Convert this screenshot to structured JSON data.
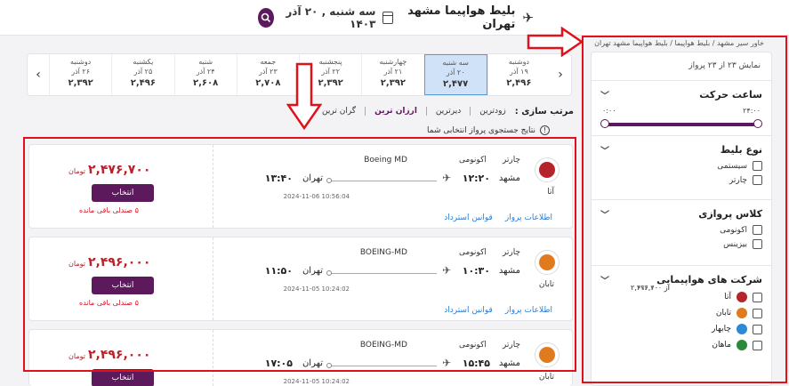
{
  "header": {
    "title": "بلیط هواپیما مشهد تهران",
    "date": "سه شنبه , ۲۰ آذر ۱۴۰۳",
    "search_icon": "search-icon",
    "plane_icon": "airplane-icon",
    "calendar_icon": "calendar-icon"
  },
  "breadcrumb": "خاور سیر مشهد / بلیط هواپیما / بلیط هواپیما مشهد تهران",
  "sidebar": {
    "count_text": "نمایش ۲۳ از ۲۳ پرواز",
    "time_section": {
      "title": "ساعت حرکت",
      "from": "۰:۰۰",
      "to": "۲۴:۰۰"
    },
    "ticket_type": {
      "title": "نوع بلیط",
      "options": [
        "سیستمی",
        "چارتر"
      ]
    },
    "flight_class": {
      "title": "کلاس پروازی",
      "options": [
        "اکونومی",
        "بیزینس"
      ]
    },
    "airlines": {
      "title": "شرکت های هواپیمایی",
      "items": [
        {
          "name": "آتا",
          "price": "از ۲,۴۷۶,۷۰۰",
          "color": "#b5242a"
        },
        {
          "name": "تابان",
          "price": "از ۲,۴۹۶,۰۰۰",
          "color": "#e07a1f"
        },
        {
          "name": "چابهار",
          "price": "از ۲,۶۰۰,۰۰۰",
          "color": "#2b8ad3"
        },
        {
          "name": "ماهان",
          "price": "از ۲,۶۰۷,۴۰۰",
          "color": "#2a8a3a"
        }
      ]
    }
  },
  "datestrip": {
    "days": [
      {
        "name": "دوشنبه",
        "date": "۱۹ آذر",
        "price": "۲,۴۹۶",
        "selected": false
      },
      {
        "name": "سه شنبه",
        "date": "۲۰ آذر",
        "price": "۲,۴۷۷",
        "selected": true
      },
      {
        "name": "چهارشنبه",
        "date": "۲۱ آذر",
        "price": "۲,۳۹۲",
        "selected": false
      },
      {
        "name": "پنجشنبه",
        "date": "۲۲ آذر",
        "price": "۲,۳۹۲",
        "selected": false
      },
      {
        "name": "جمعه",
        "date": "۲۳ آذر",
        "price": "۲,۷۰۸",
        "selected": false
      },
      {
        "name": "شنبه",
        "date": "۲۴ آذر",
        "price": "۲,۶۰۸",
        "selected": false
      },
      {
        "name": "یکشنبه",
        "date": "۲۵ آذر",
        "price": "۲,۴۹۶",
        "selected": false
      },
      {
        "name": "دوشنبه",
        "date": "۲۶ آذر",
        "price": "۲,۳۹۲",
        "selected": false
      }
    ]
  },
  "sort": {
    "label": "مرتب سازی :",
    "options": [
      "زودترین",
      "دیرترین",
      "ارزان ترین",
      "گران ترین"
    ],
    "active": 2
  },
  "notice": "نتایج جستجوی پرواز انتخابی شما",
  "flights": [
    {
      "airline": "آتا",
      "logo_color": "#b5242a",
      "type": "چارتر",
      "class": "اکونومی",
      "aircraft": "Boeing MD",
      "origin": "مشهد",
      "dep_time": "۱۲:۲۰",
      "dest": "تهران",
      "arr_time": "۱۳:۴۰",
      "stamp": "2024-11-06 10:56:04",
      "price": "۲,۴۷۶,۷۰۰",
      "currency": "تومان",
      "button": "انتخاب",
      "seats": "۵ صندلی باقی مانده",
      "link_info": "اطلاعات پرواز",
      "link_refund": "قوانین استرداد"
    },
    {
      "airline": "تابان",
      "logo_color": "#e07a1f",
      "type": "چارتر",
      "class": "اکونومی",
      "aircraft": "BOEING-MD",
      "origin": "مشهد",
      "dep_time": "۱۰:۳۰",
      "dest": "تهران",
      "arr_time": "۱۱:۵۰",
      "stamp": "2024-11-05 10:24:02",
      "price": "۲,۴۹۶,۰۰۰",
      "currency": "تومان",
      "button": "انتخاب",
      "seats": "۵ صندلی باقی مانده",
      "link_info": "اطلاعات پرواز",
      "link_refund": "قوانین استرداد"
    },
    {
      "airline": "تابان",
      "logo_color": "#e07a1f",
      "type": "چارتر",
      "class": "اکونومی",
      "aircraft": "BOEING-MD",
      "origin": "مشهد",
      "dep_time": "۱۵:۴۵",
      "dest": "تهران",
      "arr_time": "۱۷:۰۵",
      "stamp": "2024-11-05 10:24:02",
      "price": "۲,۴۹۶,۰۰۰",
      "currency": "تومان",
      "button": "انتخاب",
      "seats": "",
      "link_info": "",
      "link_refund": ""
    }
  ]
}
